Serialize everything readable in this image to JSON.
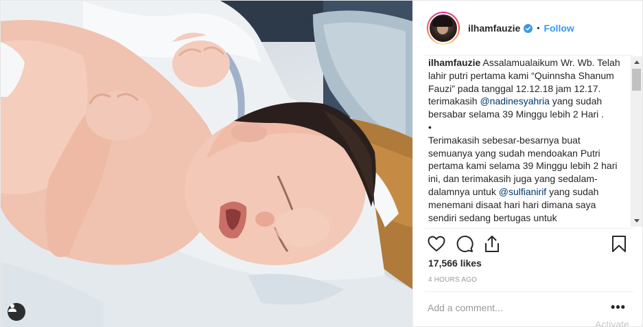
{
  "post": {
    "username": "ilhamfauzie",
    "separator": "•",
    "follow_label": "Follow",
    "caption": {
      "username": "ilhamfauzie",
      "p1_a": "Assalamualaikum Wr. Wb. Telah lahir putri pertama kami “Quinnsha Shanum Fauzi” pada tanggal 12.12.18 jam 12.17. terimakasih ",
      "mention1": "@nadinesyahria",
      "p1_b": " yang sudah bersabar selama 39 Minggu lebih 2 Hari .",
      "bullet": "•",
      "p2_a": "Terimakasih sebesar-besarnya buat semuanya yang sudah mendoakan Putri pertama kami selama 39 Minggu lebih 2 hari ini, dan terimakasih juga yang sedalam-dalamnya untuk ",
      "mention2": "@sulfianirif",
      "p2_b": " yang sudah menemani disaat hari hari dimana saya sendiri sedang bertugas untuk"
    },
    "likes": "17,566 likes",
    "time": "4 HOURS AGO",
    "comment_placeholder": "Add a comment...",
    "more_label": "•••"
  },
  "icons": {
    "like": "heart-icon",
    "comment": "comment-icon",
    "share": "share-icon",
    "save": "bookmark-icon",
    "verified": "verified-badge-icon",
    "tag": "user-tag-icon"
  },
  "colors": {
    "link": "#3897f0",
    "mention": "#003569",
    "text": "#262626",
    "muted": "#999999"
  },
  "watermark": "Activate"
}
